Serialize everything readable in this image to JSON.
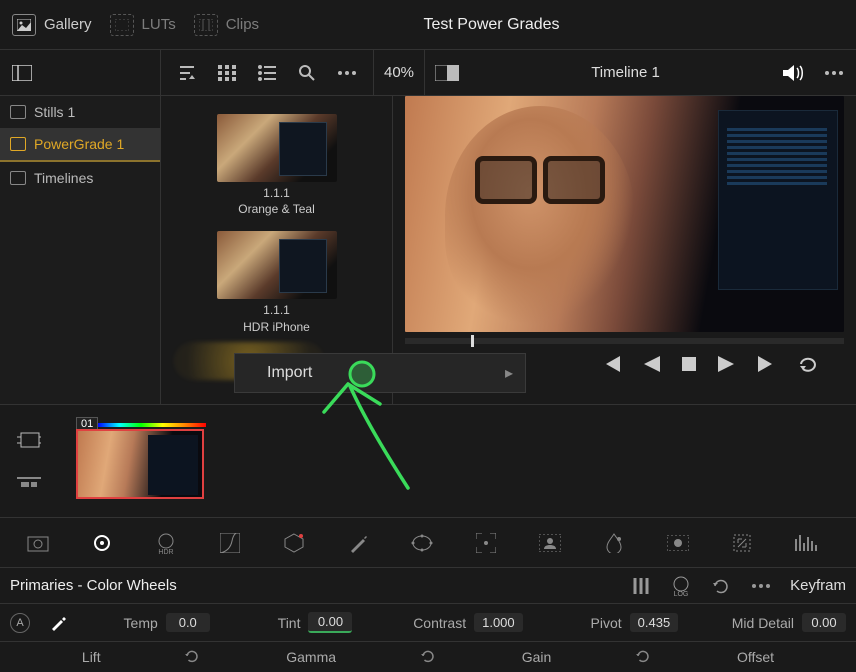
{
  "topbar": {
    "gallery": "Gallery",
    "luts": "LUTs",
    "clips": "Clips",
    "title": "Test Power Grades"
  },
  "toolbar": {
    "zoom": "40%",
    "timeline_name": "Timeline 1"
  },
  "sidebar": {
    "items": [
      {
        "label": "Stills 1"
      },
      {
        "label": "PowerGrade 1"
      },
      {
        "label": "Timelines"
      }
    ]
  },
  "gallery": {
    "items": [
      {
        "id": "1.1.1",
        "name": "Orange & Teal"
      },
      {
        "id": "1.1.1",
        "name": "HDR iPhone"
      }
    ]
  },
  "context_menu": {
    "import": "Import"
  },
  "clip": {
    "badge": "01"
  },
  "primaries": {
    "title": "Primaries - Color Wheels",
    "keyframe": "Keyfram"
  },
  "params": {
    "temp_label": "Temp",
    "temp_val": "0.0",
    "tint_label": "Tint",
    "tint_val": "0.00",
    "contrast_label": "Contrast",
    "contrast_val": "1.000",
    "pivot_label": "Pivot",
    "pivot_val": "0.435",
    "middetail_label": "Mid Detail",
    "middetail_val": "0.00"
  },
  "wheels": {
    "lift": "Lift",
    "gamma": "Gamma",
    "gain": "Gain",
    "offset": "Offset"
  }
}
